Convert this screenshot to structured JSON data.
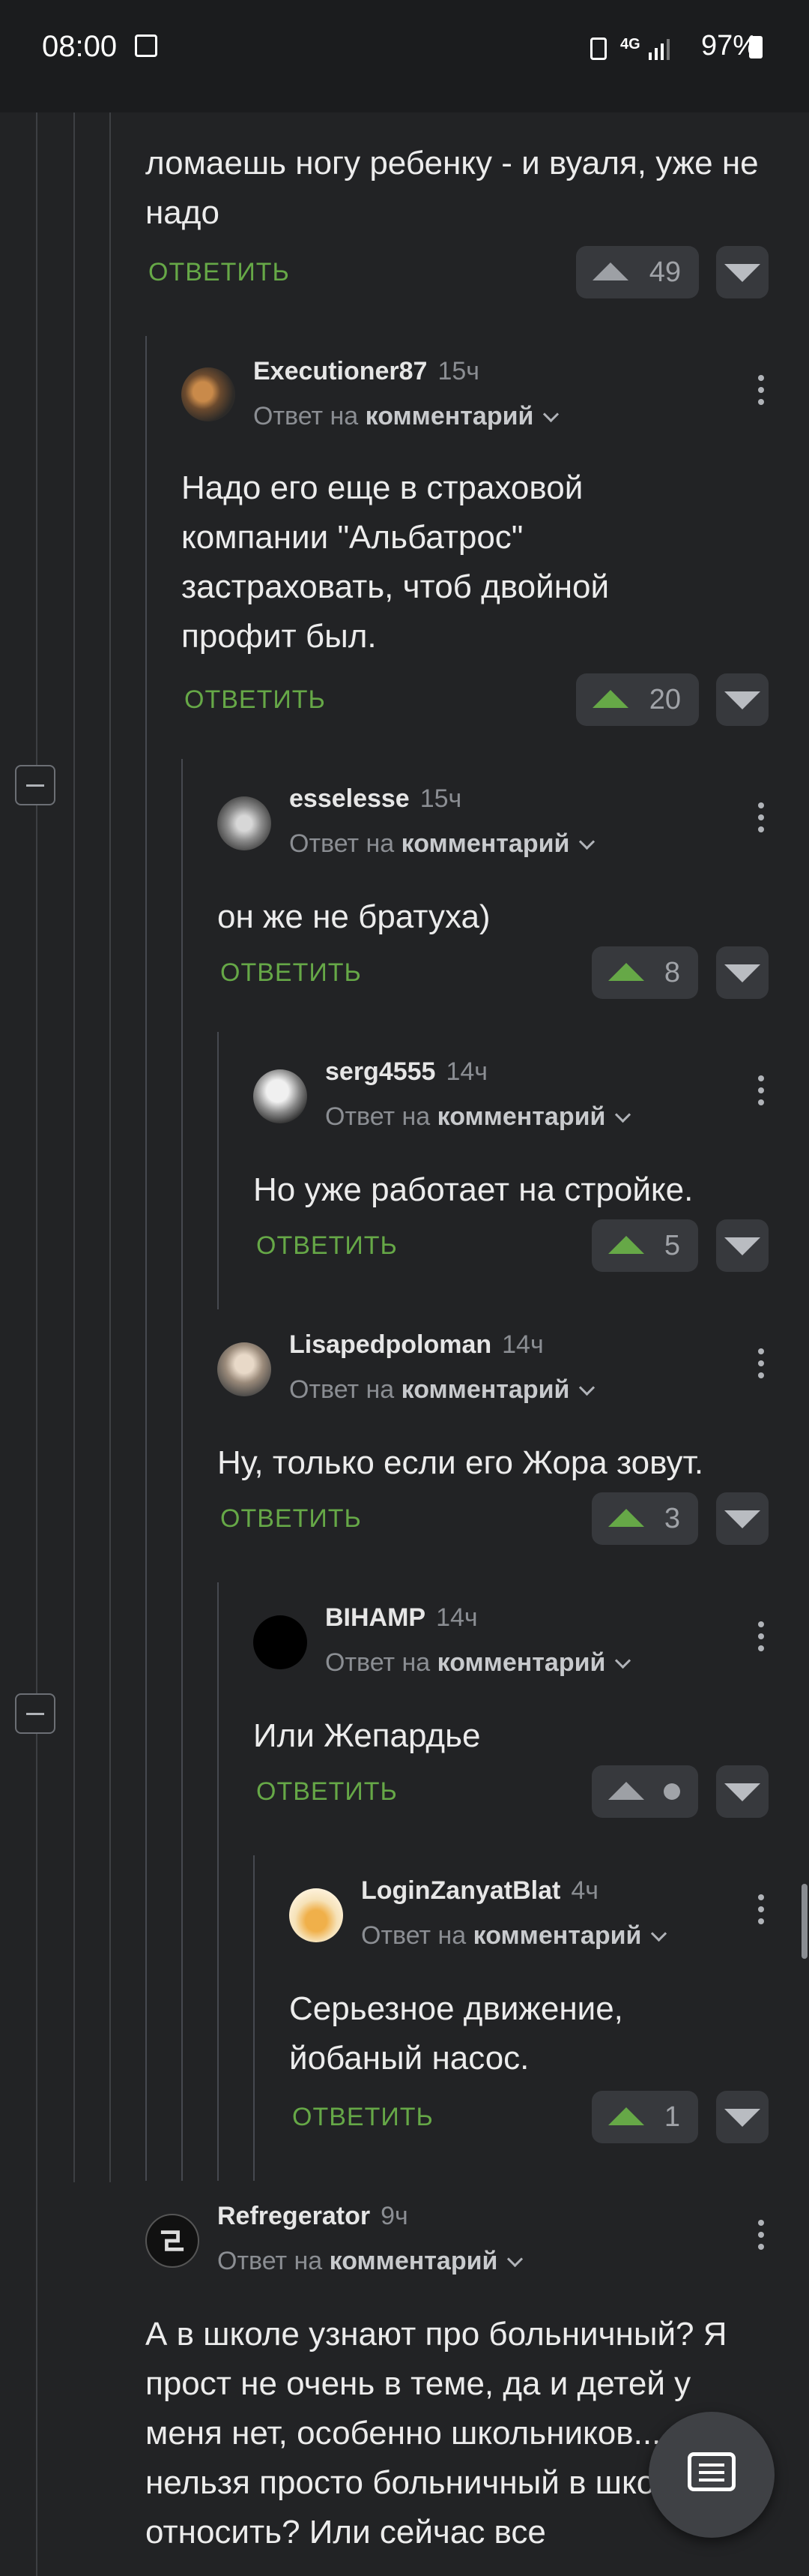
{
  "status_bar": {
    "time": "08:00",
    "network": "4G",
    "battery": "97%"
  },
  "reply_label": "ОТВЕТИТЬ",
  "reply_to_prefix": "Ответ на",
  "reply_to_target": "комментарий",
  "top_comment": {
    "text": "ломаешь ногу ребенку - и вуаля, уже не надо",
    "votes": "49"
  },
  "comments": [
    {
      "username": "Executioner87",
      "time": "15ч",
      "text": "Надо его еще в страховой компании \"Альбатрос\" застраховать, чтоб двойной профит был.",
      "votes": "20"
    },
    {
      "username": "esselesse",
      "time": "15ч",
      "text": "он же не братуха)",
      "votes": "8"
    },
    {
      "username": "serg4555",
      "time": "14ч",
      "text": "Но уже работает на стройке.",
      "votes": "5"
    },
    {
      "username": "Lisapedpoloman",
      "time": "14ч",
      "text": "Ну, только если его Жора зовут.",
      "votes": "3"
    },
    {
      "username": "BIHAMP",
      "time": "14ч",
      "text": "Или Жепардье",
      "votes": ""
    },
    {
      "username": "LoginZanyatBlat",
      "time": "4ч",
      "text": "Серьезное движение, йобаный насос.",
      "votes": "1"
    },
    {
      "username": "Refregerator",
      "time": "9ч",
      "text": "А в школе узнают про больничный? Я прост не очень в теме, да и детей у меня нет, особенно школьников... разве нельзя просто больничный в школу не относить? Или сейчас все",
      "votes": ""
    }
  ],
  "icons": {
    "upvote": "upvote-icon",
    "downvote": "downvote-icon",
    "more": "more-vertical-icon",
    "collapse": "collapse-thread-icon",
    "new_comment": "comment-icon"
  },
  "colors": {
    "accent_green": "#66a847",
    "background": "#222325"
  }
}
